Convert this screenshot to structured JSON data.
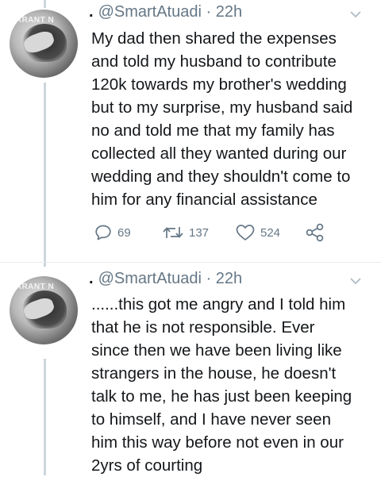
{
  "tweets": [
    {
      "handle": "@SmartAtuadi",
      "separator": "·",
      "time": "22h",
      "avatar_watermark": "UARANT N",
      "lines": [
        "My dad then shared the expenses",
        "and told my husband to contribute",
        "120k towards my brother's wedding",
        "but to my surprise, my husband said",
        "no and told me that my family has",
        "collected all they wanted during our",
        "wedding and they shouldn't come to",
        "him for any financial assistance"
      ],
      "replies": "69",
      "retweets": "137",
      "likes": "524"
    },
    {
      "handle": "@SmartAtuadi",
      "separator": "·",
      "time": "22h",
      "avatar_watermark": "UARANT N",
      "lines": [
        "......this got me angry and I told him",
        "that he is not responsible. Ever",
        "since then we have been living like",
        "strangers in the house, he doesn't",
        "talk to me, he has just been keeping",
        "to himself, and I have never seen",
        "him this way before not even in our",
        "2yrs of courting"
      ]
    }
  ],
  "icons": {
    "reply": "reply-icon",
    "retweet": "retweet-icon",
    "like": "heart-icon",
    "share": "share-icon",
    "more": "chevron-down-icon"
  },
  "colors": {
    "text": "#14171a",
    "muted": "#657786",
    "thread_line": "#ccd6dd"
  }
}
